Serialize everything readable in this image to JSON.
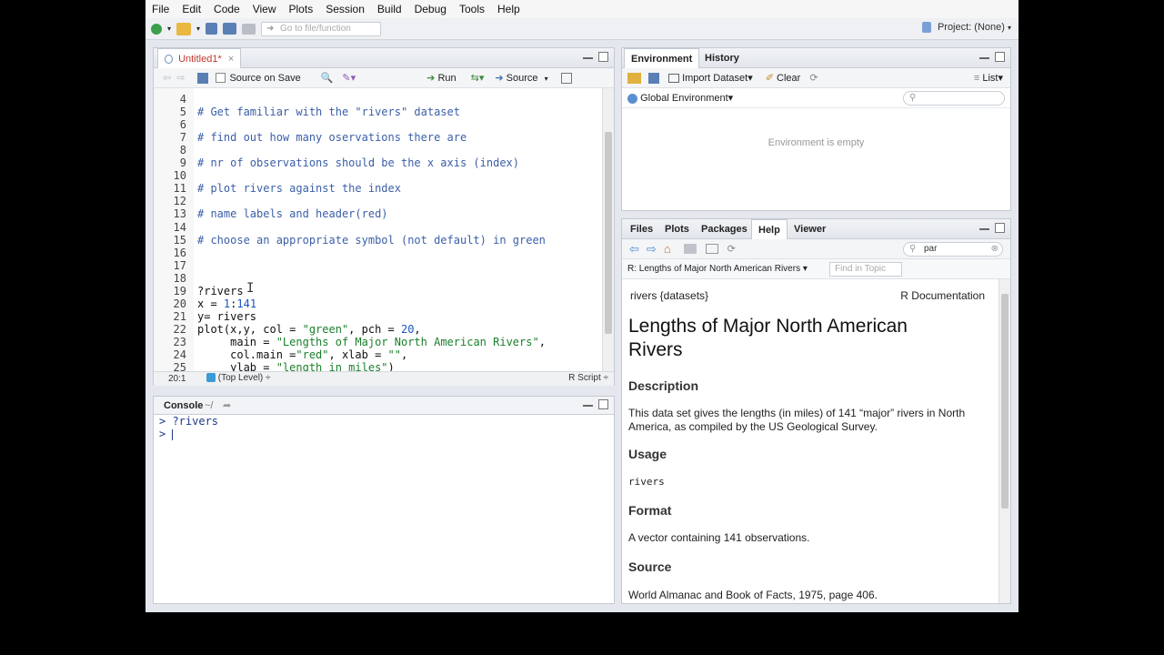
{
  "menu": [
    "File",
    "Edit",
    "Code",
    "View",
    "Plots",
    "Session",
    "Build",
    "Debug",
    "Tools",
    "Help"
  ],
  "toolbar": {
    "goto_placeholder": "Go to file/function",
    "project": "Project: (None)"
  },
  "editor": {
    "tab": "Untitled1*",
    "source_on_save": "Source on Save",
    "run": "Run",
    "source": "Source",
    "lines": [
      {
        "n": "4",
        "text": "",
        "kind": "plain"
      },
      {
        "n": "5",
        "text": "# Get familiar with the \"rivers\" dataset",
        "kind": "cmt"
      },
      {
        "n": "6",
        "text": "",
        "kind": "plain"
      },
      {
        "n": "7",
        "text": "# find out how many oservations there are",
        "kind": "cmt"
      },
      {
        "n": "8",
        "text": "",
        "kind": "plain"
      },
      {
        "n": "9",
        "text": "# nr of observations should be the x axis (index)",
        "kind": "cmt"
      },
      {
        "n": "10",
        "text": "",
        "kind": "plain"
      },
      {
        "n": "11",
        "text": "# plot rivers against the index",
        "kind": "cmt"
      },
      {
        "n": "12",
        "text": "",
        "kind": "plain"
      },
      {
        "n": "13",
        "text": "# name labels and header(red)",
        "kind": "cmt"
      },
      {
        "n": "14",
        "text": "",
        "kind": "plain"
      },
      {
        "n": "15",
        "text": "# choose an appropriate symbol (not default) in green",
        "kind": "cmt"
      },
      {
        "n": "16",
        "text": "",
        "kind": "plain"
      },
      {
        "n": "17",
        "text": "",
        "kind": "plain"
      },
      {
        "n": "18",
        "text": "",
        "kind": "plain"
      },
      {
        "n": "19",
        "text": "?rivers",
        "kind": "plain"
      },
      {
        "n": "20",
        "text": "x = 1:141",
        "kind": "plain"
      },
      {
        "n": "21",
        "text": "y= rivers",
        "kind": "plain"
      },
      {
        "n": "22",
        "text": "plot(x,y, col = \"green\", pch = 20,",
        "kind": "plain"
      },
      {
        "n": "23",
        "text": "     main = \"Lengths of Major North American Rivers\",",
        "kind": "plain"
      },
      {
        "n": "24",
        "text": "     col.main =\"red\", xlab = \"\",",
        "kind": "plain"
      },
      {
        "n": "25",
        "text": "     ylab = \"length in miles\")",
        "kind": "plain"
      }
    ],
    "cursor_pos": "20:1",
    "scope": "(Top Level)",
    "filetype": "R Script"
  },
  "console": {
    "title": "Console",
    "path": "~/",
    "lines": [
      "> ?rivers",
      "> "
    ]
  },
  "environment": {
    "tabs": [
      "Environment",
      "History"
    ],
    "import": "Import Dataset",
    "clear": "Clear",
    "list": "List",
    "scope": "Global Environment",
    "empty": "Environment is empty"
  },
  "help": {
    "tabs": [
      "Files",
      "Plots",
      "Packages",
      "Help",
      "Viewer"
    ],
    "search_value": "par",
    "topic": "R: Lengths of Major North American Rivers",
    "find_placeholder": "Find in Topic",
    "pkg": "rivers {datasets}",
    "rdoc": "R Documentation",
    "title": "Lengths of Major North American Rivers",
    "sections": [
      {
        "heading": "Description",
        "body": "This data set gives the lengths (in miles) of 141 “major” rivers in North America, as compiled by the US Geological Survey."
      },
      {
        "heading": "Usage",
        "body": "rivers"
      },
      {
        "heading": "Format",
        "body": "A vector containing 141 observations."
      },
      {
        "heading": "Source",
        "body": "World Almanac and Book of Facts, 1975, page 406."
      }
    ]
  }
}
